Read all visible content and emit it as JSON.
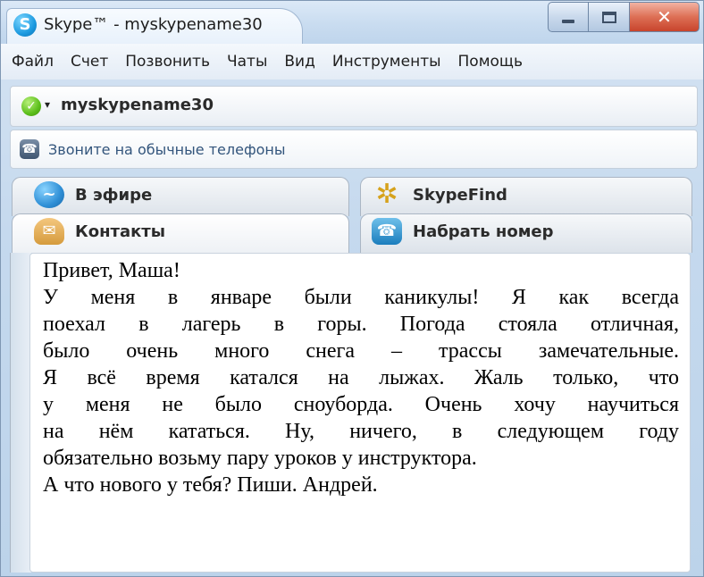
{
  "window": {
    "title": "Skype™ - myskypename30",
    "app_icon": "S",
    "close_glyph": "✕"
  },
  "menu": [
    "Файл",
    "Счет",
    "Позвонить",
    "Чаты",
    "Вид",
    "Инструменты",
    "Помощь"
  ],
  "account": {
    "name": "myskypename30",
    "status_icon": "online-status-icon",
    "dropdown": "▾"
  },
  "call_bar": {
    "label": "Звоните на обычные телефоны",
    "icon": "phone-icon"
  },
  "tabs": [
    {
      "label": "В эфире",
      "icon": "online-icon"
    },
    {
      "label": "SkypeFind",
      "icon": "skypefind-icon"
    },
    {
      "label": "Контакты",
      "icon": "contacts-icon"
    },
    {
      "label": "Набрать номер",
      "icon": "dial-icon"
    }
  ],
  "message": {
    "greeting": "Привет, Маша!",
    "lines": [
      "У меня в январе были каникулы! Я как всегда",
      "поехал в лагерь в горы. Погода стояла отличная,",
      "было очень много снега – трассы замечательные.",
      "Я всё время катался на лыжах. Жаль только, что",
      "у меня не было сноуборда. Очень хочу научиться",
      "на нём кататься. Ну, ничего, в следующем году",
      "обязательно возьму пару уроков у инструктора."
    ],
    "closing": "А что нового у тебя? Пиши. Андрей."
  },
  "colors": {
    "window_frame": "#c5d9ee",
    "close_button": "#dd6f55",
    "link": "#33557c"
  }
}
